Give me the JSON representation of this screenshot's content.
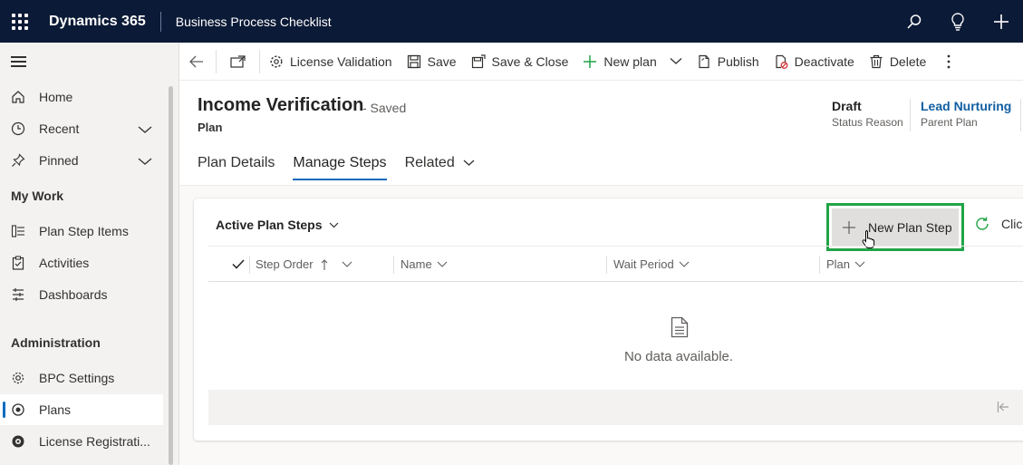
{
  "topbar": {
    "brand": "Dynamics 365",
    "app_name": "Business Process Checklist",
    "icons": [
      "search-icon",
      "lightbulb-icon",
      "plus-icon"
    ]
  },
  "nav": {
    "items": [
      {
        "label": "Home",
        "icon": "home-icon"
      },
      {
        "label": "Recent",
        "icon": "clock-icon"
      },
      {
        "label": "Pinned",
        "icon": "pin-icon"
      }
    ],
    "sections": [
      {
        "title": "My Work",
        "items": [
          {
            "label": "Plan Step Items",
            "icon": "list-icon"
          },
          {
            "label": "Activities",
            "icon": "clipboard-icon"
          },
          {
            "label": "Dashboards",
            "icon": "dashboard-icon"
          }
        ]
      },
      {
        "title": "Administration",
        "items": [
          {
            "label": "BPC Settings",
            "icon": "settings-icon"
          },
          {
            "label": "Plans",
            "icon": "plans-icon",
            "selected": true
          },
          {
            "label": "License Registrati...",
            "icon": "license-icon"
          }
        ]
      }
    ]
  },
  "commands": {
    "license_validation": "License Validation",
    "save": "Save",
    "save_close": "Save & Close",
    "new_plan": "New plan",
    "publish": "Publish",
    "deactivate": "Deactivate",
    "delete": "Delete"
  },
  "header": {
    "title": "Income Verification",
    "saved": "- Saved",
    "entity": "Plan",
    "status_value": "Draft",
    "status_label": "Status Reason",
    "parent_value": "Lead Nurturing",
    "parent_label": "Parent Plan",
    "tabs": [
      "Plan Details",
      "Manage Steps",
      "Related"
    ],
    "active_tab": "Manage Steps"
  },
  "subgrid": {
    "view_name": "Active Plan Steps",
    "new_button": "New Plan Step",
    "refresh_label": "Click",
    "columns": [
      "Step Order",
      "Name",
      "Wait Period",
      "Plan"
    ],
    "empty_text": "No data available."
  },
  "colors": {
    "topbar": "#0b1a36",
    "accent": "#0f6cbd",
    "highlight": "#21a446",
    "link": "#115ea3"
  }
}
